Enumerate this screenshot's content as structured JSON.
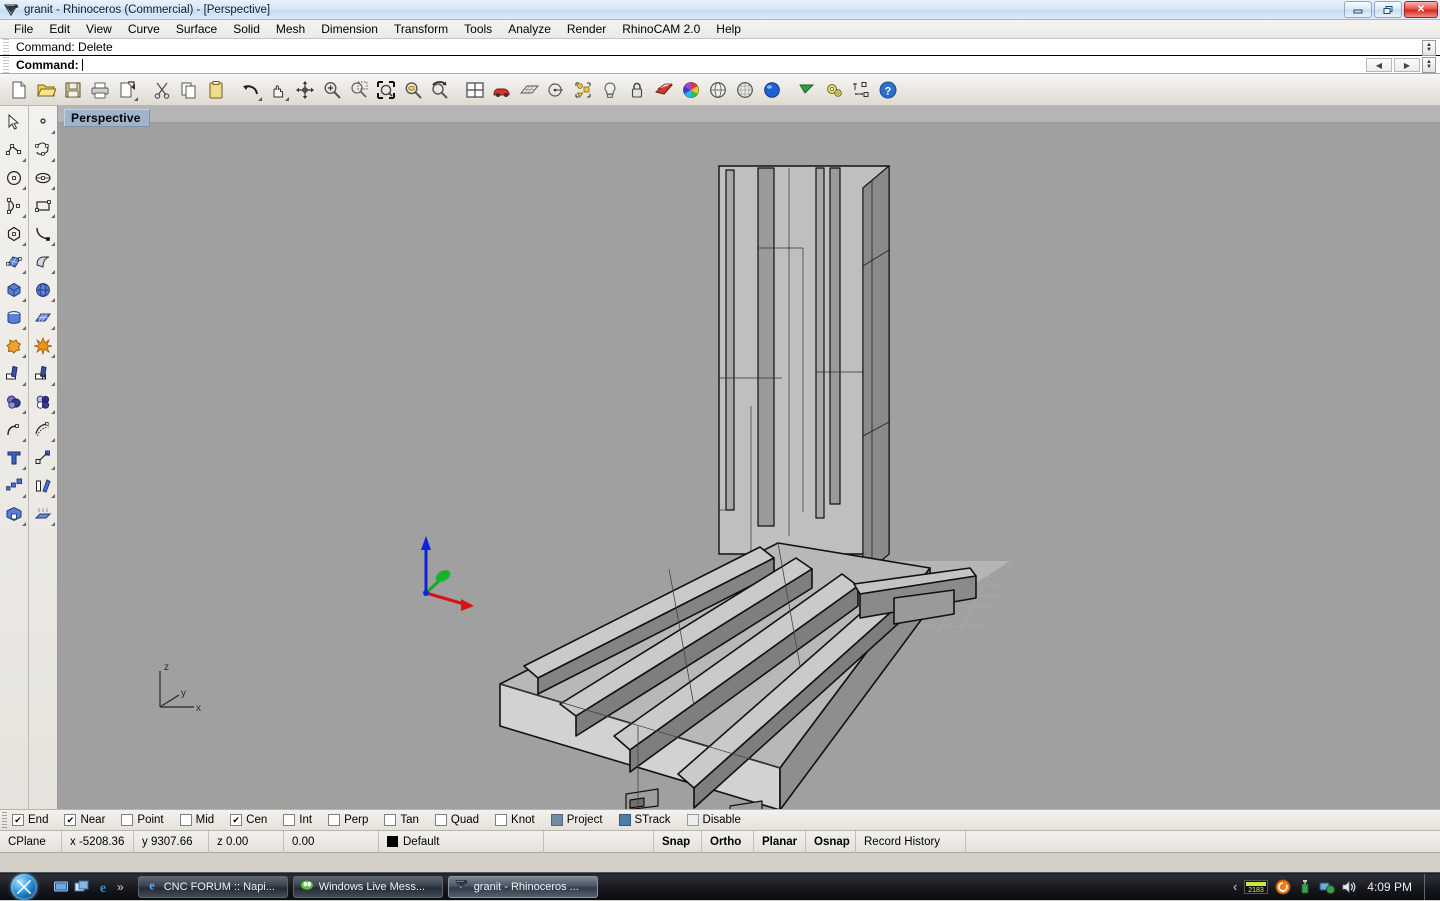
{
  "window": {
    "title": "granit - Rhinoceros (Commercial) - [Perspective]",
    "app_icon": "rhino-icon",
    "buttons": {
      "minimize": "–",
      "restore": "❐",
      "close": "✕"
    }
  },
  "menubar": {
    "items": [
      {
        "label": "File",
        "name": "menu-file"
      },
      {
        "label": "Edit",
        "name": "menu-edit"
      },
      {
        "label": "View",
        "name": "menu-view"
      },
      {
        "label": "Curve",
        "name": "menu-curve"
      },
      {
        "label": "Surface",
        "name": "menu-surface"
      },
      {
        "label": "Solid",
        "name": "menu-solid"
      },
      {
        "label": "Mesh",
        "name": "menu-mesh"
      },
      {
        "label": "Dimension",
        "name": "menu-dimension"
      },
      {
        "label": "Transform",
        "name": "menu-transform"
      },
      {
        "label": "Tools",
        "name": "menu-tools"
      },
      {
        "label": "Analyze",
        "name": "menu-analyze"
      },
      {
        "label": "Render",
        "name": "menu-render"
      },
      {
        "label": "RhinoCAM 2.0",
        "name": "menu-rhinocam"
      },
      {
        "label": "Help",
        "name": "menu-help"
      }
    ]
  },
  "command": {
    "history_line": "Command: Delete",
    "prompt_label": "Command:",
    "input_value": ""
  },
  "toolbar": {
    "icons": [
      "new-file-icon",
      "open-folder-icon",
      "save-icon",
      "print-icon",
      "print-preview-icon",
      "cut-scissors-icon",
      "copy-icon",
      "paste-clipboard-icon",
      "undo-arrow-icon",
      "pan-hand-icon",
      "rotate-view-icon",
      "zoom-in-icon",
      "zoom-window-icon",
      "zoom-extents-icon",
      "zoom-selected-icon",
      "zoom-previous-icon",
      "viewport-layout-icon",
      "car-render-icon",
      "grid-plane-icon",
      "center-point-icon",
      "group-objects-icon",
      "lightbulb-icon",
      "lock-icon",
      "layers-icon",
      "color-wheel-icon",
      "shaded-sphere-icon",
      "ghosted-sphere-icon",
      "render-sphere-icon",
      "flag-icon",
      "gears-options-icon",
      "dimension-icon",
      "help-icon"
    ]
  },
  "sidebar": {
    "left_column": [
      "select-arrow-icon",
      "polyline-icon",
      "circle-icon",
      "arc-3point-icon",
      "polygon-icon",
      "surface-from-curves-icon",
      "box-icon",
      "cylinder-icon",
      "boolean-union-icon",
      "trim-icon",
      "sphere-group-icon",
      "fillet-curve-icon",
      "text-icon",
      "scale-2d-icon",
      "box-edit-icon"
    ],
    "right_column": [
      "point-icon",
      "curve-interpolate-icon",
      "ellipse-icon",
      "rectangle-icon",
      "curve-blend-icon",
      "surface-sweep-icon",
      "sphere-icon",
      "surface-mesh-icon",
      "explode-icon",
      "split-icon",
      "boolean-difference-icon",
      "offset-curve-icon",
      "rotate-2d-icon",
      "mirror-icon",
      "extrude-icon"
    ]
  },
  "viewport": {
    "label": "Perspective",
    "axis_indicator": {
      "z": "z",
      "y": "y",
      "x": "x"
    },
    "background_color": "#a0a0a0",
    "gizmo": {
      "x_color": "#dd1111",
      "y_color": "#11aa22",
      "z_color": "#1122dd"
    },
    "cplane_axis_color": "#cc4444"
  },
  "osnap": {
    "items": [
      {
        "label": "End",
        "state": "checked"
      },
      {
        "label": "Near",
        "state": "checked"
      },
      {
        "label": "Point",
        "state": "unchecked"
      },
      {
        "label": "Mid",
        "state": "unchecked"
      },
      {
        "label": "Cen",
        "state": "checked"
      },
      {
        "label": "Int",
        "state": "unchecked"
      },
      {
        "label": "Perp",
        "state": "unchecked"
      },
      {
        "label": "Tan",
        "state": "unchecked"
      },
      {
        "label": "Quad",
        "state": "unchecked"
      },
      {
        "label": "Knot",
        "state": "unchecked"
      },
      {
        "label": "Project",
        "state": "filled"
      },
      {
        "label": "STrack",
        "state": "filled2"
      },
      {
        "label": "Disable",
        "state": "blank"
      }
    ]
  },
  "statusbar": {
    "cplane_label": "CPlane",
    "x": "x -5208.36",
    "y": "y 9307.66",
    "z": "z 0.00",
    "extra": "0.00",
    "layer": "Default",
    "layer_color": "#000000",
    "toggles": [
      "Snap",
      "Ortho",
      "Planar",
      "Osnap"
    ],
    "record_history": "Record History"
  },
  "taskbar": {
    "start_name": "start-orb",
    "quicklaunch": [
      "show-desktop-icon",
      "switch-windows-icon",
      "internet-explorer-icon"
    ],
    "overflow_chevron": "»",
    "tasks": [
      {
        "label": "CNC FORUM :: Napi...",
        "icon": "internet-explorer-icon",
        "active": false
      },
      {
        "label": "Windows Live Mess...",
        "icon": "messenger-icon",
        "active": false
      },
      {
        "label": "granit - Rhinoceros ...",
        "icon": "rhino-icon",
        "active": true
      }
    ],
    "tray": {
      "chevron": "‹",
      "counter": "2183",
      "icons": [
        "counter-display-icon",
        "orange-circle-icon",
        "usb-device-icon",
        "network-icon",
        "volume-icon"
      ],
      "clock": "4:09 PM"
    }
  }
}
